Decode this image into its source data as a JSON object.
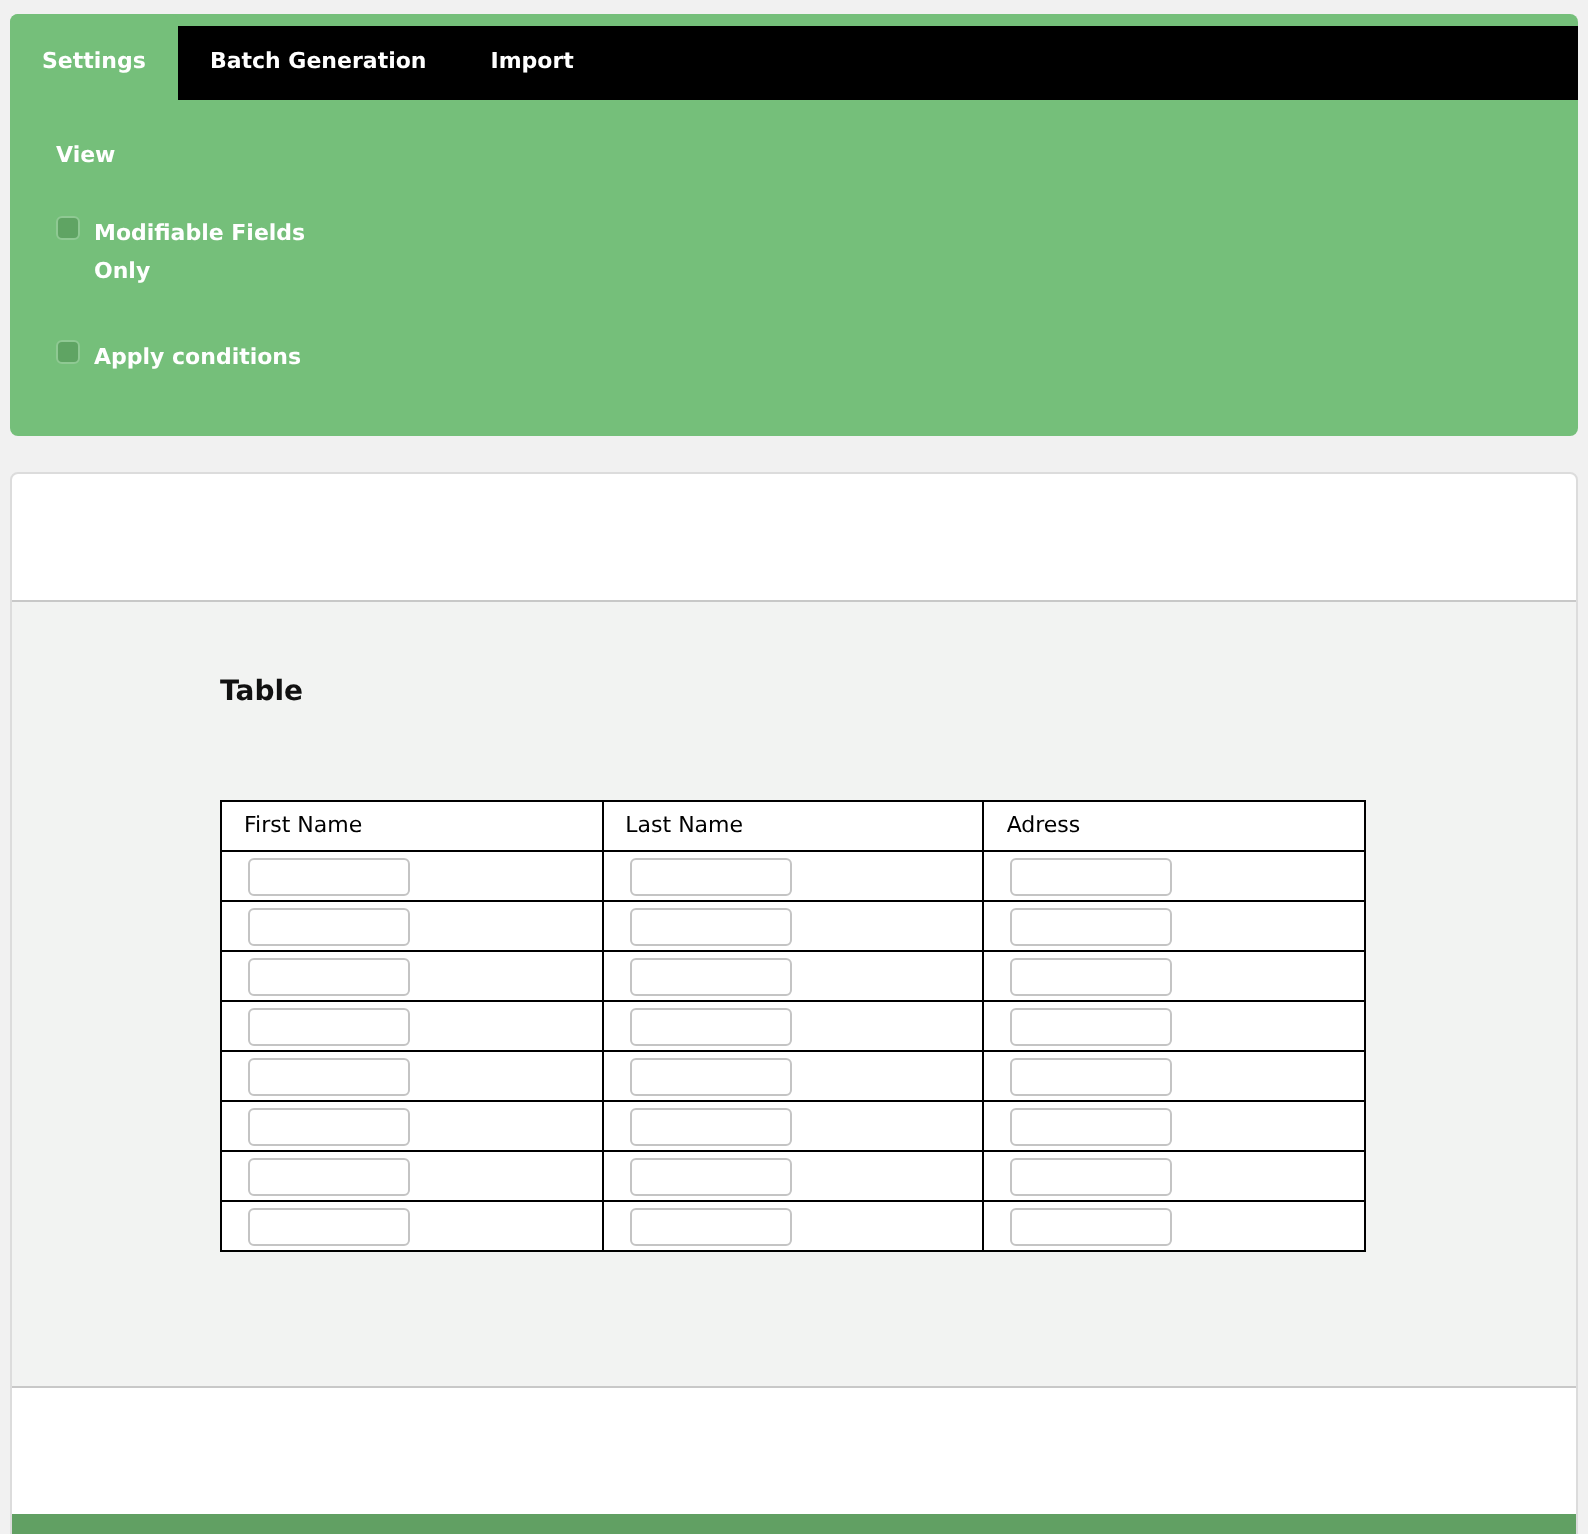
{
  "tabs": [
    {
      "label": "Settings",
      "selected": true
    },
    {
      "label": "Batch Generation",
      "selected": false
    },
    {
      "label": "Import",
      "selected": false
    }
  ],
  "settings": {
    "heading": "View",
    "options": [
      {
        "label": "Modifiable Fields Only",
        "checked": false
      },
      {
        "label": "Apply conditions",
        "checked": false
      }
    ]
  },
  "table": {
    "title": "Table",
    "columns": [
      "First Name",
      "Last Name",
      "Adress"
    ],
    "rows": [
      {
        "kind": "inputs"
      },
      {
        "kind": "inputs"
      },
      {
        "kind": "inputs"
      },
      {
        "kind": "inputs"
      },
      {
        "kind": "inputs"
      },
      {
        "kind": "inputs"
      },
      {
        "kind": "inputs"
      },
      {
        "kind": "inputs"
      }
    ]
  }
}
